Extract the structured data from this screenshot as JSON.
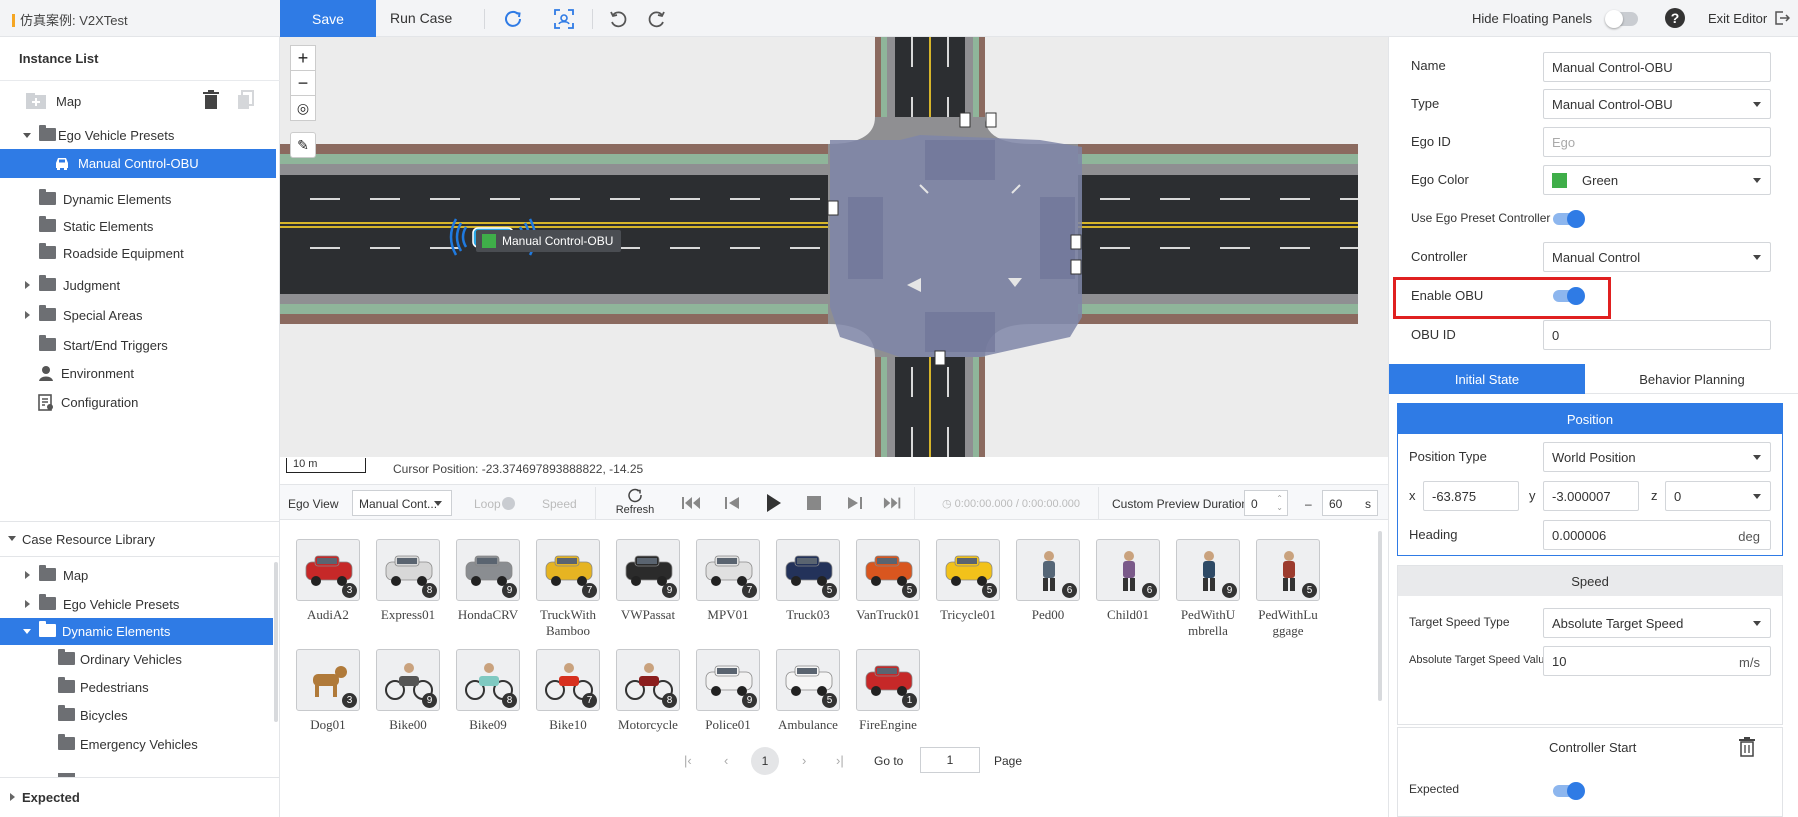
{
  "topbar": {
    "case_title": "仿真案例: V2XTest",
    "save_label": "Save",
    "run_case_label": "Run Case",
    "hide_floating_panels_label": "Hide Floating Panels",
    "exit_editor_label": "Exit Editor"
  },
  "instance_list": {
    "title": "Instance List",
    "items": [
      {
        "label": "Map"
      },
      {
        "label": "Ego Vehicle Presets"
      },
      {
        "label": "Manual Control-OBU"
      },
      {
        "label": "Dynamic Elements"
      },
      {
        "label": "Static Elements"
      },
      {
        "label": "Roadside Equipment"
      },
      {
        "label": "Judgment"
      },
      {
        "label": "Special Areas"
      },
      {
        "label": "Start/End Triggers"
      },
      {
        "label": "Environment"
      },
      {
        "label": "Configuration"
      }
    ]
  },
  "case_library": {
    "title": "Case Resource Library",
    "items": [
      {
        "label": "Map"
      },
      {
        "label": "Ego Vehicle Presets"
      },
      {
        "label": "Dynamic Elements"
      },
      {
        "label": "Ordinary Vehicles"
      },
      {
        "label": "Pedestrians"
      },
      {
        "label": "Bicycles"
      },
      {
        "label": "Emergency Vehicles"
      }
    ],
    "expected_label": "Expected"
  },
  "map": {
    "vehicle_label": "Manual Control-OBU",
    "scale_label": "10 m",
    "cursor_position": "Cursor Position: -23.374697893888822, -14.25",
    "colors": {
      "road": "#2c2e31",
      "sidewalk": "#8b6a5f",
      "grass": "#8fb59a",
      "junction": "#7f86a8"
    }
  },
  "playback": {
    "ego_view_label": "Ego View",
    "ego_view_value": "Manual Cont...",
    "loop_label": "Loop",
    "speed_label": "Speed",
    "refresh_label": "Refresh",
    "time_display": "0:00:00.000 / 0:00:00.000",
    "custom_preview_label": "Custom Preview Duration",
    "start_value": "0",
    "dash": "–",
    "end_value": "60",
    "unit": "s"
  },
  "gallery": {
    "items": [
      {
        "name": "AudiA2",
        "count": "3",
        "icon": "car-icon",
        "color": "#c62828"
      },
      {
        "name": "Express01",
        "count": "8",
        "icon": "van-icon",
        "color": "#d8d8d8"
      },
      {
        "name": "HondaCRV",
        "count": "9",
        "icon": "suv-icon",
        "color": "#8a8d91"
      },
      {
        "name": "TruckWith Bamboo",
        "count": "7",
        "icon": "truck-icon",
        "color": "#e6b422"
      },
      {
        "name": "VWPassat",
        "count": "9",
        "icon": "car-icon",
        "color": "#2b2b2b"
      },
      {
        "name": "MPV01",
        "count": "7",
        "icon": "van-icon",
        "color": "#e0e0e0"
      },
      {
        "name": "Truck03",
        "count": "5",
        "icon": "truck-icon",
        "color": "#23325a"
      },
      {
        "name": "VanTruck01",
        "count": "5",
        "icon": "truck-icon",
        "color": "#d9561f"
      },
      {
        "name": "Tricycle01",
        "count": "5",
        "icon": "tricycle-icon",
        "color": "#f2c21a"
      },
      {
        "name": "Ped00",
        "count": "6",
        "icon": "pedestrian-icon",
        "color": "#556677"
      },
      {
        "name": "Child01",
        "count": "6",
        "icon": "child-icon",
        "color": "#7a5a8a"
      },
      {
        "name": "PedWithU mbrella",
        "count": "9",
        "icon": "umbrella-pedestrian-icon",
        "color": "#2e4a66"
      },
      {
        "name": "PedWithLu ggage",
        "count": "5",
        "icon": "luggage-pedestrian-icon",
        "color": "#9c3b2e"
      },
      {
        "name": "Dog01",
        "count": "3",
        "icon": "dog-icon",
        "color": "#b07a3a"
      },
      {
        "name": "Bike00",
        "count": "9",
        "icon": "bicycle-icon",
        "color": "#555555"
      },
      {
        "name": "Bike09",
        "count": "8",
        "icon": "scooter-icon",
        "color": "#7fc9c1"
      },
      {
        "name": "Bike10",
        "count": "7",
        "icon": "scooter-icon",
        "color": "#d7301f"
      },
      {
        "name": "Motorcycle",
        "count": "8",
        "icon": "motorcycle-icon",
        "color": "#8b1e1e"
      },
      {
        "name": "Police01",
        "count": "9",
        "icon": "police-car-icon",
        "color": "#f2f2f2"
      },
      {
        "name": "Ambulance",
        "count": "5",
        "icon": "ambulance-icon",
        "color": "#f5f5f5"
      },
      {
        "name": "FireEngine",
        "count": "1",
        "icon": "fire-engine-icon",
        "color": "#c62828"
      }
    ],
    "pager": {
      "current": "1",
      "goto_label": "Go to",
      "goto_value": "1",
      "page_label": "Page"
    }
  },
  "properties": {
    "name_label": "Name",
    "name_value": "Manual Control-OBU",
    "type_label": "Type",
    "type_value": "Manual Control-OBU",
    "ego_id_label": "Ego ID",
    "ego_id_placeholder": "Ego",
    "ego_color_label": "Ego Color",
    "ego_color_value": "Green",
    "ego_color_swatch": "#3fae49",
    "use_preset_label": "Use Ego Preset Controller",
    "controller_label": "Controller",
    "controller_value": "Manual Control",
    "enable_obu_label": "Enable OBU",
    "obu_id_label": "OBU ID",
    "obu_id_value": "0",
    "tabs": {
      "initial_state": "Initial State",
      "behavior_planning": "Behavior Planning"
    },
    "position": {
      "title": "Position",
      "type_label": "Position Type",
      "type_value": "World Position",
      "x_label": "x",
      "x_value": "-63.875",
      "y_label": "y",
      "y_value": "-3.000007",
      "z_label": "z",
      "z_value": "0",
      "heading_label": "Heading",
      "heading_value": "0.000006",
      "heading_unit": "deg"
    },
    "speed": {
      "title": "Speed",
      "target_type_label": "Target Speed Type",
      "target_type_value": "Absolute Target Speed",
      "abs_value_label": "Absolute Target Speed Value",
      "abs_value": "10",
      "unit": "m/s"
    },
    "controller_start": {
      "title": "Controller Start",
      "expected_label": "Expected"
    },
    "accent_color": "#2f7be5",
    "highlight_color": "#e02020"
  }
}
